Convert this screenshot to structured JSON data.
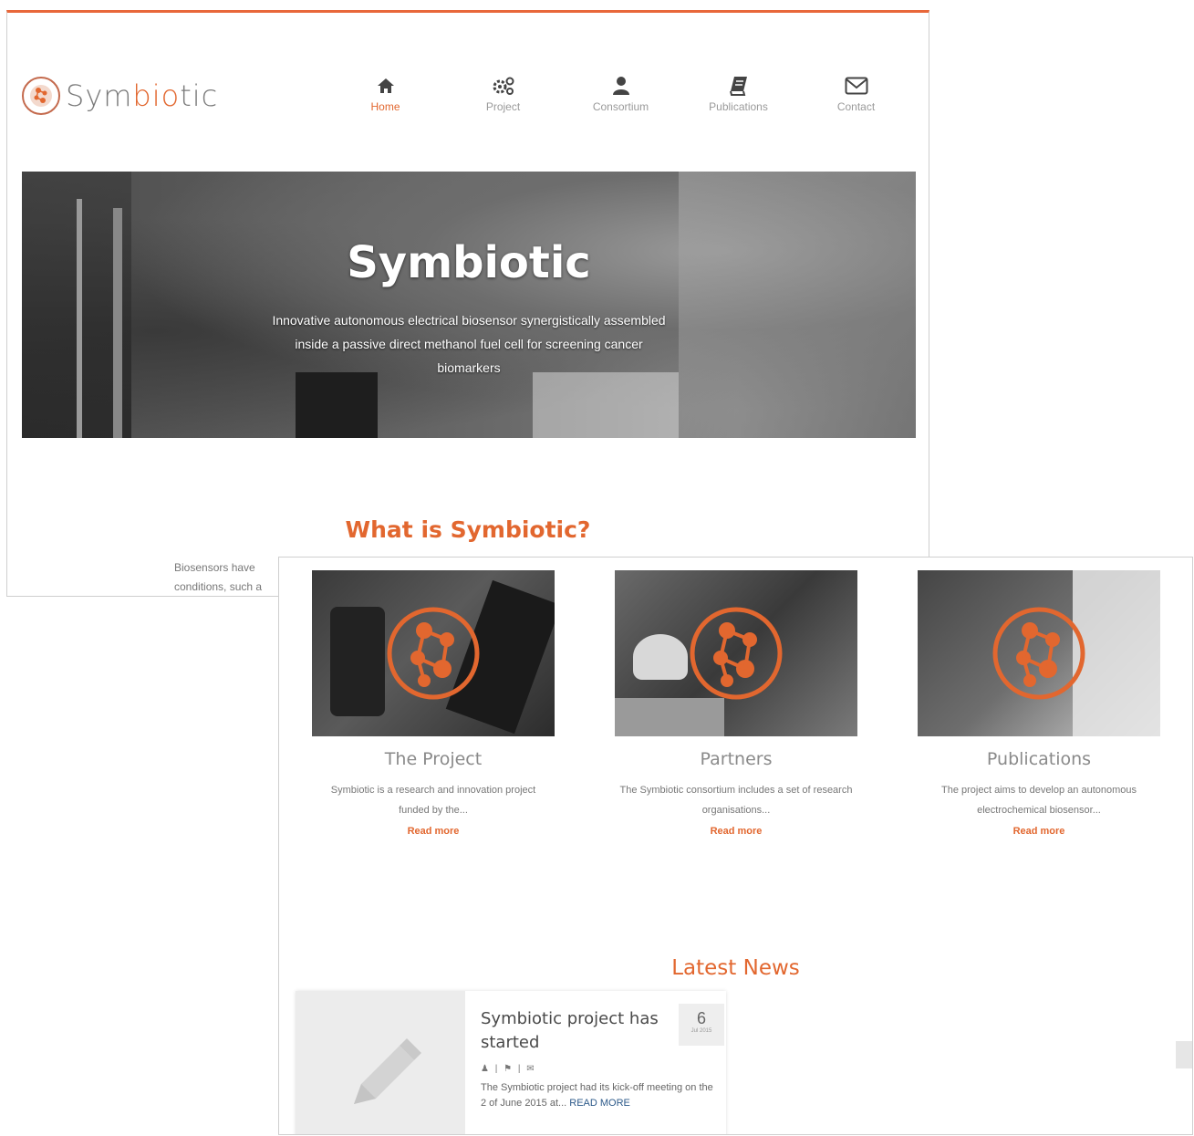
{
  "brand": {
    "logo_text_pre": "Sym",
    "logo_text_accent": "bio",
    "logo_text_post": "tic",
    "accent_color": "#e2672f"
  },
  "nav": {
    "items": [
      {
        "label": "Home",
        "icon": "home-icon",
        "active": true
      },
      {
        "label": "Project",
        "icon": "gears-icon"
      },
      {
        "label": "Consortium",
        "icon": "user-icon"
      },
      {
        "label": "Publications",
        "icon": "book-icon"
      },
      {
        "label": "Contact",
        "icon": "envelope-icon"
      }
    ]
  },
  "hero": {
    "title": "Symbiotic",
    "subtitle": "Innovative autonomous electrical biosensor synergistically assembled inside a passive direct methanol fuel cell for screening cancer biomarkers"
  },
  "about": {
    "title": "What is Symbiotic?",
    "text_line1": "Biosensors have",
    "text_line2": "conditions, such a"
  },
  "cards": [
    {
      "title": "The Project",
      "desc": "Symbiotic is a research and innovation project funded by the...",
      "more": "Read more"
    },
    {
      "title": "Partners",
      "desc": "The Symbiotic consortium includes a set of research organisations...",
      "more": "Read more"
    },
    {
      "title": "Publications",
      "desc": "The project aims to develop an autonomous electrochemical biosensor...",
      "more": "Read more"
    }
  ],
  "news": {
    "section_title": "Latest News",
    "items": [
      {
        "title": "Symbiotic project has started",
        "day": "6",
        "month": "Jul 2015",
        "text": "The Symbiotic project had its kick-off meeting on the 2 of June 2015 at...",
        "read_more": "READ MORE"
      }
    ]
  }
}
